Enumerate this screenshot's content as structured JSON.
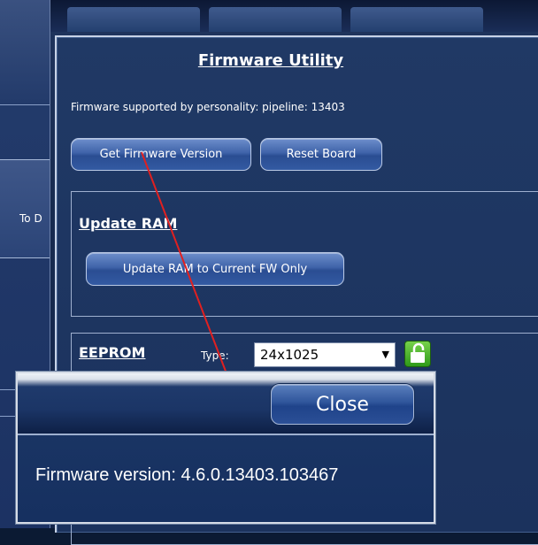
{
  "background": {
    "left_label": "To D"
  },
  "firmware_utility": {
    "title": "Firmware Utility",
    "supported_text": "Firmware supported by personality:  pipeline: 13403",
    "get_fw_button": "Get Firmware Version",
    "reset_button": "Reset Board",
    "update_ram": {
      "title": "Update RAM",
      "button": "Update RAM to Current FW Only"
    },
    "eeprom": {
      "title": "EEPROM",
      "type_label": "Type:",
      "type_value": "24x1025",
      "lock_icon": "unlock-icon"
    }
  },
  "dialog": {
    "close_label": "Close",
    "message": "Firmware version: 4.6.0.13403.103467"
  },
  "colors": {
    "arrow": "#e02020",
    "panel": "#1b325d",
    "button": "#3f63a9"
  }
}
